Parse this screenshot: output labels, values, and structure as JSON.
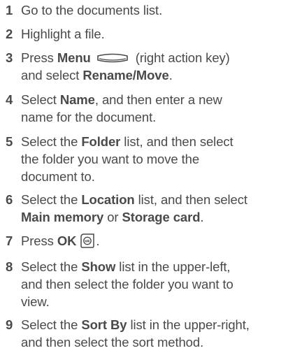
{
  "steps": [
    {
      "num": "1",
      "text": "Go to the documents list."
    },
    {
      "num": "2",
      "text": "Highlight a file."
    },
    {
      "num": "3",
      "pre": "Press ",
      "bold1": "Menu",
      "mid": " (right action key)",
      "line2_pre": "and select ",
      "bold2": "Rename/Move",
      "post": ".",
      "icon": "menu-key-icon"
    },
    {
      "num": "4",
      "pre": "Select ",
      "bold1": "Name",
      "post1": ", and then enter a new",
      "line2": "name for the document."
    },
    {
      "num": "5",
      "pre": "Select the ",
      "bold1": "Folder",
      "post1": " list, and then select",
      "line2": "the folder you want to move the",
      "line3": "document to."
    },
    {
      "num": "6",
      "pre": "Select the ",
      "bold1": "Location",
      "post1": " list, and then select",
      "bold2": "Main memory",
      "mid2": " or ",
      "bold3": "Storage card",
      "post2": "."
    },
    {
      "num": "7",
      "pre": "Press ",
      "bold1": "OK",
      "post": ".",
      "icon": "ok-key-icon"
    },
    {
      "num": "8",
      "pre": "Select the ",
      "bold1": "Show",
      "post1": " list in the upper-left,",
      "line2": "and then select the folder you want to",
      "line3": "view."
    },
    {
      "num": "9",
      "pre": "Select the ",
      "bold1": "Sort By",
      "post1": " list in the upper-right,",
      "line2": "and then select the sort method."
    }
  ]
}
